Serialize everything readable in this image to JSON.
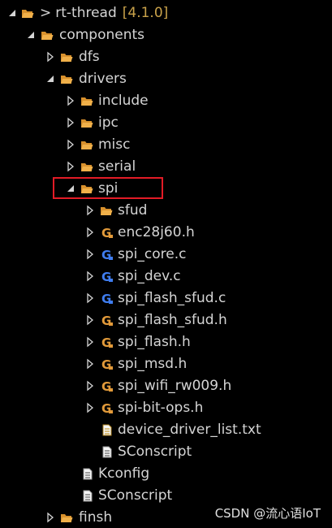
{
  "tree": {
    "root": {
      "prefix": ">",
      "label": "rt-thread",
      "version": "[4.1.0]"
    },
    "components": {
      "label": "components"
    },
    "dfs": {
      "label": "dfs"
    },
    "drivers": {
      "label": "drivers"
    },
    "include": {
      "label": "include"
    },
    "ipc": {
      "label": "ipc"
    },
    "misc": {
      "label": "misc"
    },
    "serial": {
      "label": "serial"
    },
    "spi": {
      "label": "spi"
    },
    "sfud": {
      "label": "sfud"
    },
    "files": [
      {
        "label": "enc28j60.h",
        "icon": "h-header-icon"
      },
      {
        "label": "spi_core.c",
        "icon": "c-source-icon"
      },
      {
        "label": "spi_dev.c",
        "icon": "c-source-icon"
      },
      {
        "label": "spi_flash_sfud.c",
        "icon": "c-source-icon"
      },
      {
        "label": "spi_flash_sfud.h",
        "icon": "h-header-icon"
      },
      {
        "label": "spi_flash.h",
        "icon": "h-header-icon"
      },
      {
        "label": "spi_msd.h",
        "icon": "h-header-icon"
      },
      {
        "label": "spi_wifi_rw009.h",
        "icon": "h-header-icon"
      },
      {
        "label": "spi-bit-ops.h",
        "icon": "h-header-icon"
      }
    ],
    "device_driver_list": {
      "label": "device_driver_list.txt",
      "icon": "text-file-icon"
    },
    "spi_sconscript": {
      "label": "SConscript",
      "icon": "document-icon"
    },
    "kconfig": {
      "label": "Kconfig",
      "icon": "document-icon"
    },
    "drivers_sconscript": {
      "label": "SConscript",
      "icon": "document-icon"
    },
    "finsh": {
      "label": "finsh"
    }
  },
  "watermark": {
    "text": "CSDN @流心语IoT"
  },
  "colors": {
    "background": "#000000",
    "text": "#d4d4d4",
    "version": "#c9a24a",
    "folder": "#e8a33a",
    "c_icon": "#3f7df0",
    "h_icon": "#e29a3a",
    "highlight_border": "#e21b26"
  }
}
